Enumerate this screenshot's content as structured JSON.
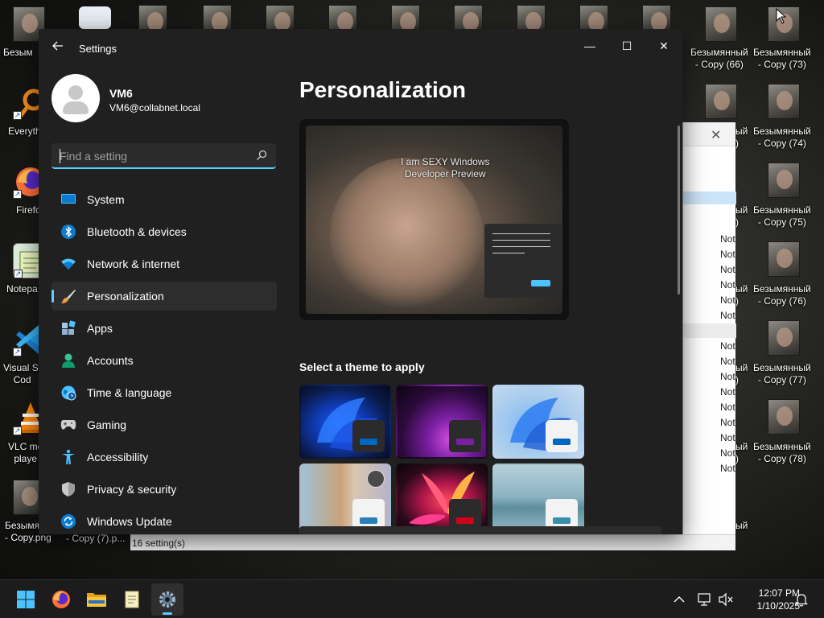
{
  "desktop": {
    "left_icons": [
      {
        "label": "Безым",
        "icon": "image-file-icon"
      },
      {
        "label": "Everyth",
        "icon": "everything-search-icon"
      },
      {
        "label": "Firefo",
        "icon": "firefox-icon"
      },
      {
        "label": "Notepa",
        "icon": "notepad-icon"
      },
      {
        "label": "Visual St\nCod",
        "icon": "vscode-icon"
      },
      {
        "label": "VLC me\nplaye",
        "icon": "vlc-icon"
      },
      {
        "label": "Безымя\n- Copy.png",
        "icon": "image-file-icon"
      }
    ],
    "bottom_labels": [
      "- Copy (7).p..."
    ],
    "right_icons": [
      {
        "line1": "Безымянный",
        "line2": "- Copy (66)"
      },
      {
        "line1": "Безымянный",
        "line2": "- Copy (73)"
      },
      {
        "line1": "Безымянный",
        "line2": "- Copy (74)"
      },
      {
        "line1": "Безымянный",
        "line2": "- Copy (75)"
      },
      {
        "line1": "Безымянный",
        "line2": "- Copy (76)"
      },
      {
        "line1": "Безымянный",
        "line2": "- Copy (77)"
      },
      {
        "line1": "Безымянный",
        "line2": "- Copy (78)"
      }
    ],
    "partial_right_labels": [
      {
        "line1": "ый",
        "line2": "66)"
      },
      {
        "line1": "ый",
        "line2": ")"
      },
      {
        "line1": "ый",
        "line2": ")"
      },
      {
        "line1": "ый",
        "line2": ")"
      },
      {
        "line1": "ый",
        "line2": ")"
      },
      {
        "line1": "ый",
        "line2": ")"
      },
      {
        "line1": "ый",
        "line2": ")"
      },
      {
        "line1": "ый",
        "line2": ""
      }
    ]
  },
  "background_window": {
    "rows": [
      "Not",
      "Not",
      "Not",
      "Not",
      "Not",
      "Not",
      "Not",
      "Not",
      "Not",
      "Not",
      "Not",
      "Not",
      "Not",
      "Not",
      "Not",
      "Not"
    ],
    "status": "16 setting(s)"
  },
  "settings": {
    "app_title": "Settings",
    "window_controls": {
      "minimize": "—",
      "maximize": "☐",
      "close": "✕"
    },
    "user": {
      "name": "VM6",
      "email": "VM6@collabnet.local"
    },
    "search": {
      "placeholder": "Find a setting"
    },
    "nav": [
      {
        "label": "System",
        "icon": "system-display-icon"
      },
      {
        "label": "Bluetooth & devices",
        "icon": "bluetooth-icon"
      },
      {
        "label": "Network & internet",
        "icon": "wifi-icon"
      },
      {
        "label": "Personalization",
        "icon": "paintbrush-icon",
        "active": true
      },
      {
        "label": "Apps",
        "icon": "apps-icon"
      },
      {
        "label": "Accounts",
        "icon": "accounts-icon"
      },
      {
        "label": "Time & language",
        "icon": "globe-clock-icon"
      },
      {
        "label": "Gaming",
        "icon": "gamepad-icon"
      },
      {
        "label": "Accessibility",
        "icon": "accessibility-icon"
      },
      {
        "label": "Privacy & security",
        "icon": "shield-icon"
      },
      {
        "label": "Windows Update",
        "icon": "windows-update-icon"
      }
    ],
    "page_title": "Personalization",
    "preview_watermark": "I am SEXY Windows\nDeveloper Preview",
    "theme_section_label": "Select a theme to apply",
    "themes": [
      {
        "name": "windows-light-bloom",
        "accent": "#0067c0"
      },
      {
        "name": "glow",
        "accent": "#7a1fa2"
      },
      {
        "name": "windows-light",
        "accent": "#0067c0"
      },
      {
        "name": "captured-motion",
        "accent": "#2b7fb8"
      },
      {
        "name": "flow",
        "accent": "#d0021b"
      },
      {
        "name": "sunrise",
        "accent": "#3a8fa8"
      }
    ]
  },
  "taskbar": {
    "apps": [
      {
        "name": "start",
        "icon": "windows-start-icon"
      },
      {
        "name": "firefox",
        "icon": "firefox-icon"
      },
      {
        "name": "file-explorer",
        "icon": "folder-icon"
      },
      {
        "name": "notepad",
        "icon": "notepad-icon"
      },
      {
        "name": "settings",
        "icon": "gear-icon",
        "active": true
      }
    ],
    "time": "12:07 PM",
    "date": "1/10/2025"
  },
  "colors": {
    "accent": "#60cdff",
    "window_bg": "#202020",
    "taskbar_bg": "#1c1c1c"
  }
}
